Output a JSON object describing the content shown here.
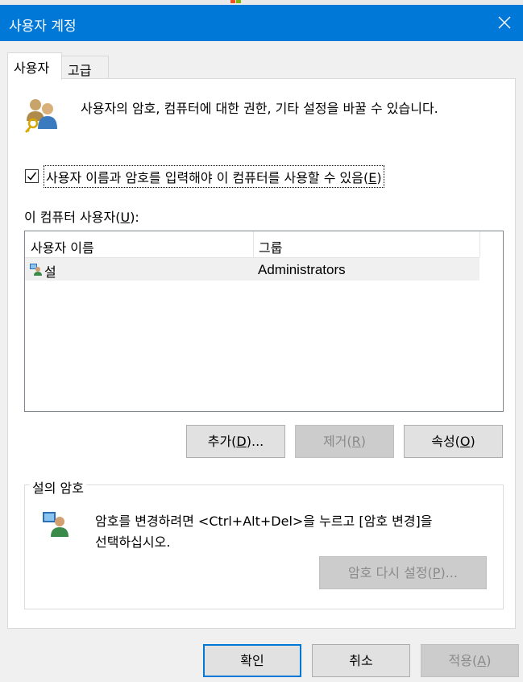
{
  "window": {
    "title": "사용자 계정"
  },
  "tabs": [
    {
      "label": "사용자",
      "active": true
    },
    {
      "label": "고급",
      "active": false
    }
  ],
  "intro_text": "사용자의 암호, 컴퓨터에 대한 권한, 기타 설정을 바꿀 수 있습니다.",
  "require_login": {
    "label_text": "사용자 이름과 암호를 입력해야 이 컴퓨터를 사용할 수 있음(",
    "label_key": "E",
    "label_end": ")",
    "checked": true
  },
  "users_list": {
    "label_text": "이 컴퓨터 사용자(",
    "label_key": "U",
    "label_end": "):",
    "columns": [
      "사용자 이름",
      "그룹"
    ],
    "rows": [
      {
        "name": "설",
        "group": "Administrators"
      }
    ]
  },
  "buttons": {
    "add": {
      "text": "추가(",
      "key": "D",
      "end": ")..."
    },
    "remove": {
      "text": "제거(",
      "key": "R",
      "end": ")"
    },
    "properties": {
      "text": "속성(",
      "key": "O",
      "end": ")"
    }
  },
  "password_group": {
    "legend": "설의 암호",
    "line1": "암호를 변경하려면 <Ctrl+Alt+Del>을 누르고 [암호 변경]을",
    "line2": "선택하십시오.",
    "reset_button": {
      "text": "암호 다시 설정(",
      "key": "P",
      "end": ")..."
    }
  },
  "dialog_buttons": {
    "ok": "확인",
    "cancel": "취소",
    "apply": {
      "text": "적용(",
      "key": "A",
      "end": ")"
    }
  },
  "colors": {
    "titlebar": "#0078d7",
    "dialog_bg": "#f0f0f0",
    "panel_bg": "#ffffff",
    "disabled_text": "#8a8a8a"
  },
  "icons": {
    "users": "users-key-icon",
    "user_row": "user-account-icon",
    "password": "user-password-icon",
    "close": "close-icon"
  }
}
